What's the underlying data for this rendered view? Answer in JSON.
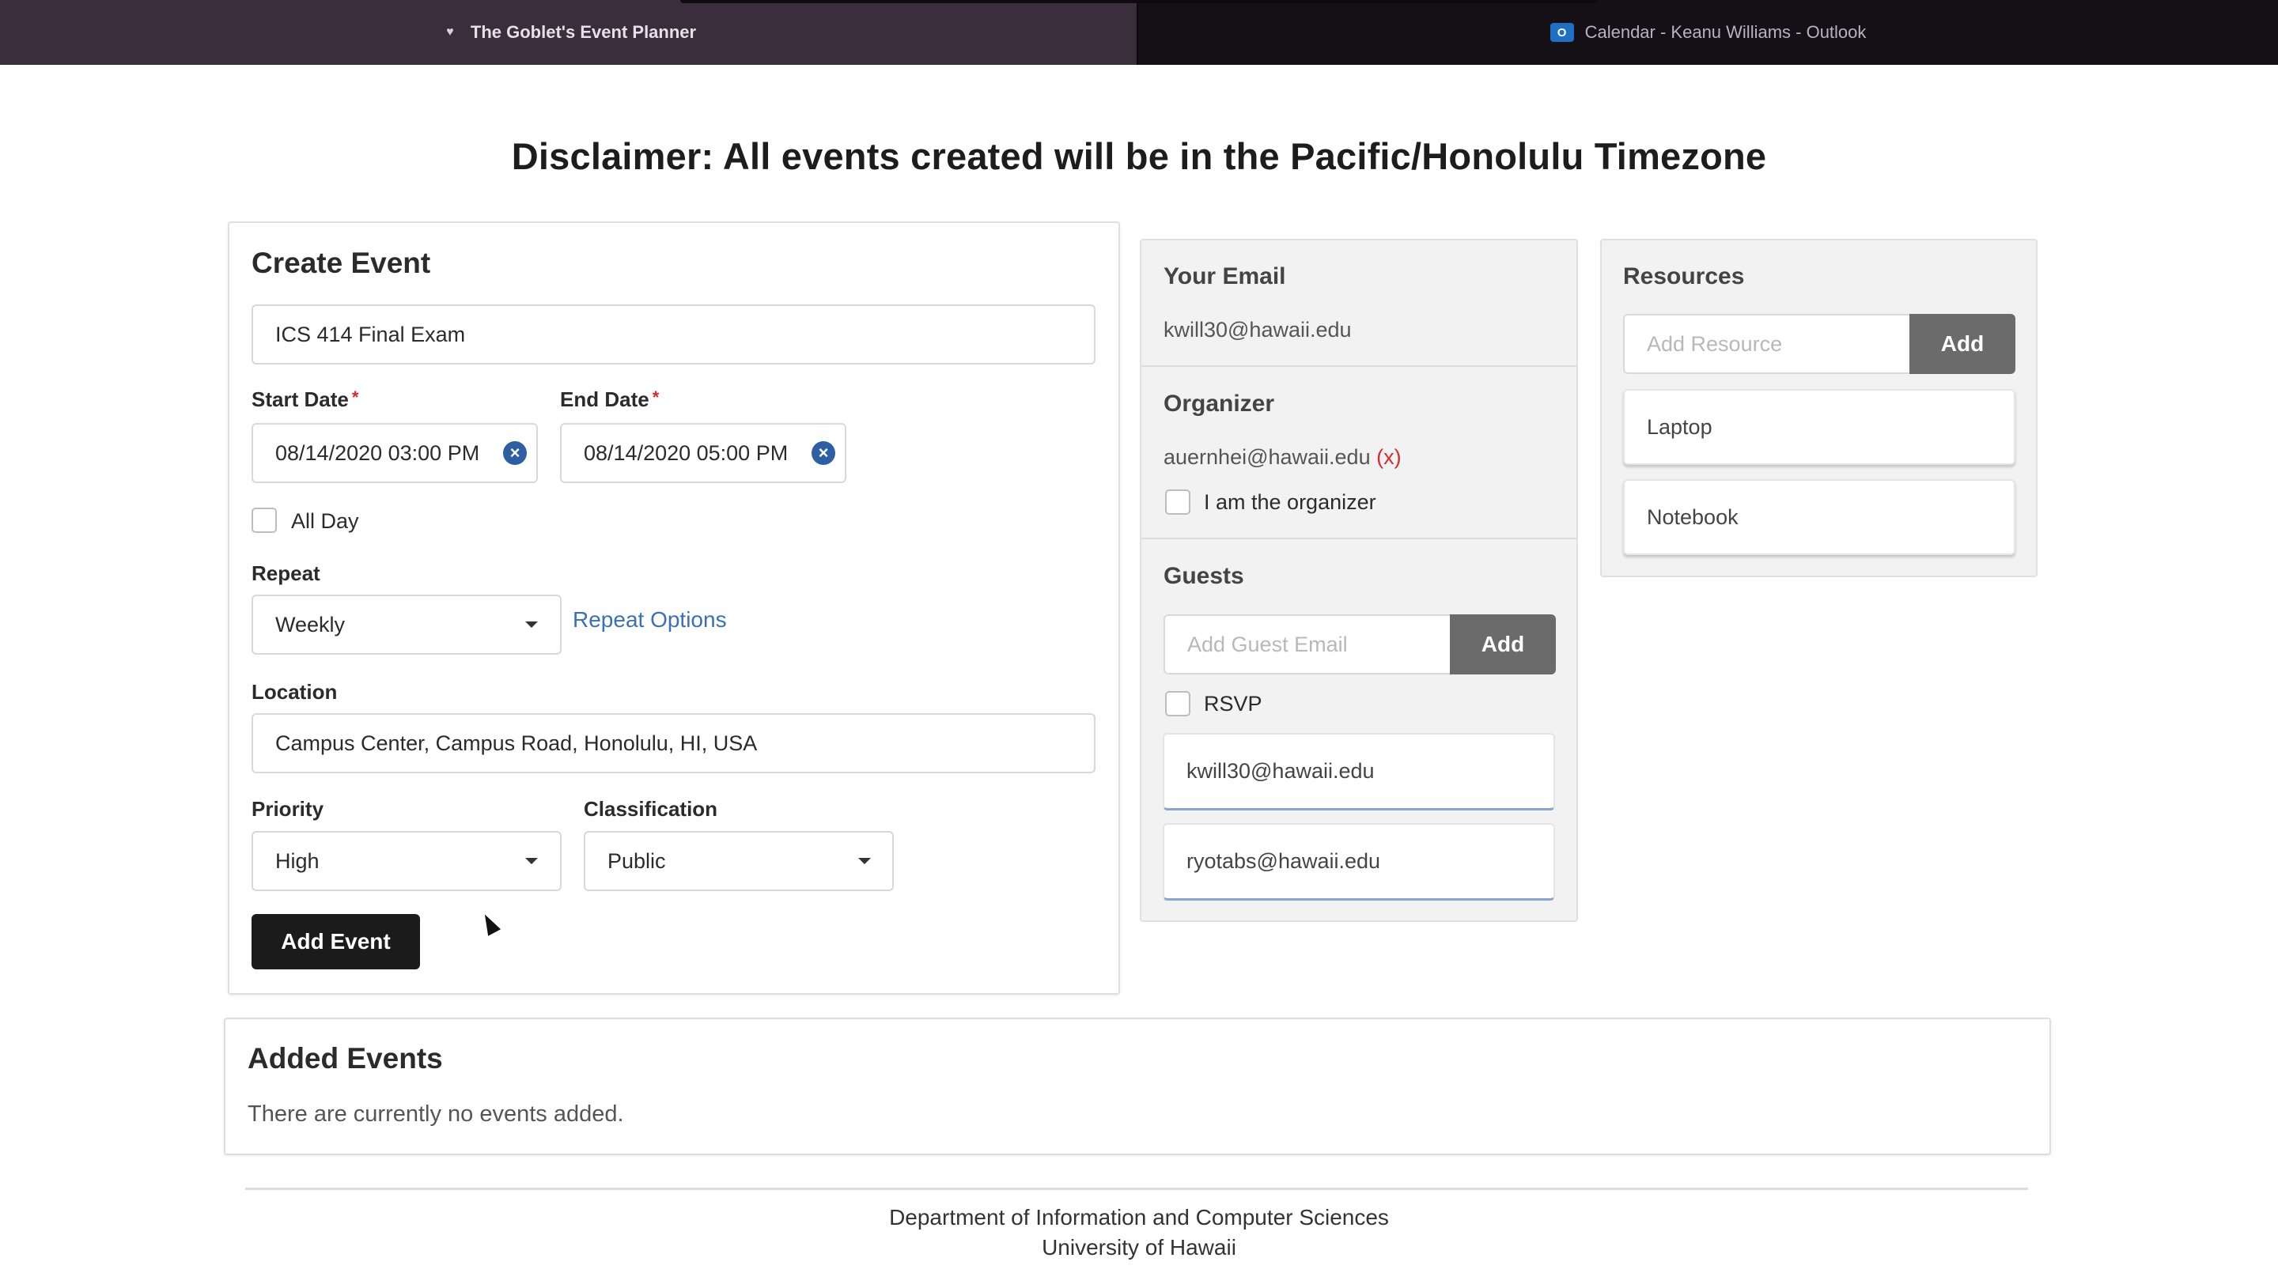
{
  "browser": {
    "tabs": [
      {
        "title": "The Goblet's Event Planner",
        "icon": "goblet-icon",
        "active": true
      },
      {
        "title": "Calendar - Keanu Williams - Outlook",
        "icon": "outlook-icon",
        "active": false
      }
    ]
  },
  "disclaimer": "Disclaimer: All events created will be in the Pacific/Honolulu Timezone",
  "create_event": {
    "title": "Create Event",
    "event_name_value": "ICS 414 Final Exam",
    "start_date_label": "Start Date",
    "start_date_value": "08/14/2020 03:00 PM",
    "end_date_label": "End Date",
    "end_date_value": "08/14/2020 05:00 PM",
    "required_mark": "*",
    "clear_symbol": "×",
    "all_day_label": "All Day",
    "repeat_label": "Repeat",
    "repeat_value": "Weekly",
    "repeat_options_link": "Repeat Options",
    "location_label": "Location",
    "location_value": "Campus Center, Campus Road, Honolulu, HI, USA",
    "priority_label": "Priority",
    "priority_value": "High",
    "classification_label": "Classification",
    "classification_value": "Public",
    "add_event_button": "Add Event"
  },
  "people_panel": {
    "your_email_title": "Your Email",
    "your_email_value": "kwill30@hawaii.edu",
    "organizer_title": "Organizer",
    "organizer_value": "auernhei@hawaii.edu",
    "organizer_remove": "(x)",
    "i_am_organizer_label": "I am the organizer",
    "guests_title": "Guests",
    "guest_input_placeholder": "Add Guest Email",
    "guest_add_button": "Add",
    "rsvp_label": "RSVP",
    "guests": [
      "kwill30@hawaii.edu",
      "ryotabs@hawaii.edu"
    ]
  },
  "resources_panel": {
    "title": "Resources",
    "input_placeholder": "Add Resource",
    "add_button": "Add",
    "items": [
      "Laptop",
      "Notebook"
    ]
  },
  "added_events": {
    "title": "Added Events",
    "empty_text": "There are currently no events added."
  },
  "footer": {
    "line1": "Department of Information and Computer Sciences",
    "line2": "University of Hawaii"
  },
  "colors": {
    "tabbar_bg": "#2e2430",
    "link": "#3b6fb6",
    "clear_icon": "#2f5fa3",
    "required": "#d62b2b",
    "primary_button": "#1b1b1b",
    "secondary_button": "#6b6b6b"
  }
}
